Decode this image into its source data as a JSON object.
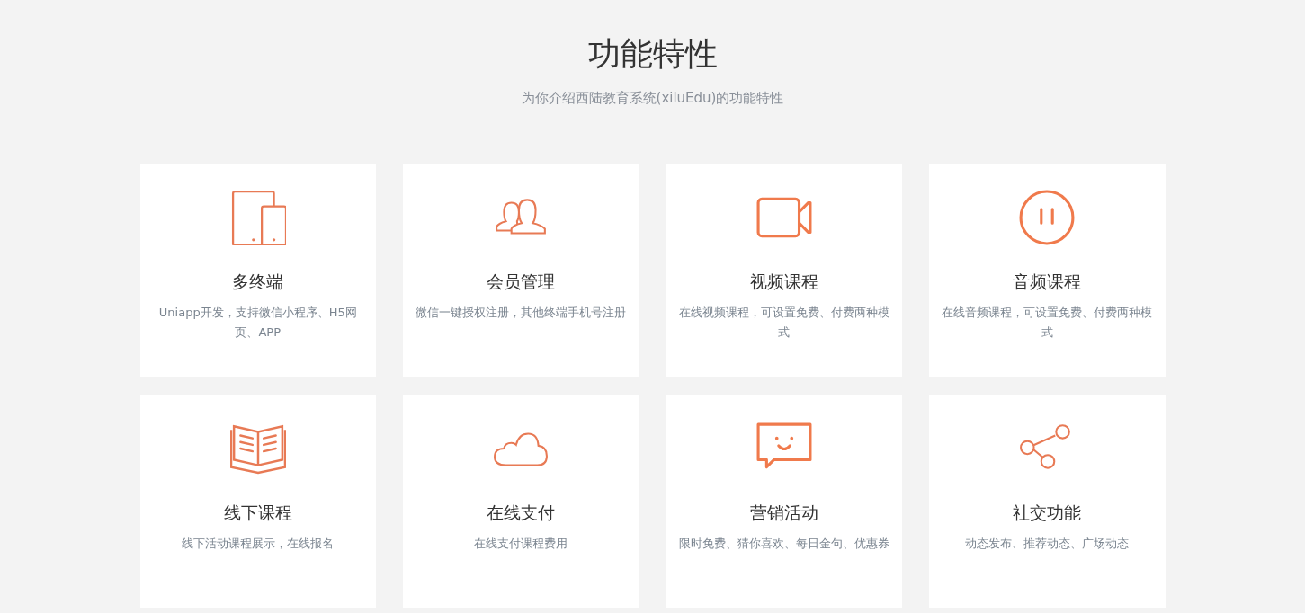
{
  "header": {
    "title": "功能特性",
    "subtitle": "为你介绍西陆教育系统(xiluEdu)的功能特性"
  },
  "features": [
    {
      "kind": "devices",
      "title": "多终端",
      "description": "Uniapp开发，支持微信小程序、H5网页、APP"
    },
    {
      "kind": "members",
      "title": "会员管理",
      "description": "微信一键授权注册，其他终端手机号注册"
    },
    {
      "kind": "video",
      "title": "视频课程",
      "description": "在线视频课程，可设置免费、付费两种模式"
    },
    {
      "kind": "audio",
      "title": "音频课程",
      "description": "在线音频课程，可设置免费、付费两种模式"
    },
    {
      "kind": "book",
      "title": "线下课程",
      "description": "线下活动课程展示，在线报名"
    },
    {
      "kind": "cloud",
      "title": "在线支付",
      "description": "在线支付课程费用"
    },
    {
      "kind": "chat",
      "title": "营销活动",
      "description": "限时免费、猜你喜欢、每日金句、优惠券"
    },
    {
      "kind": "share",
      "title": "社交功能",
      "description": "动态发布、推荐动态、广场动态"
    }
  ]
}
